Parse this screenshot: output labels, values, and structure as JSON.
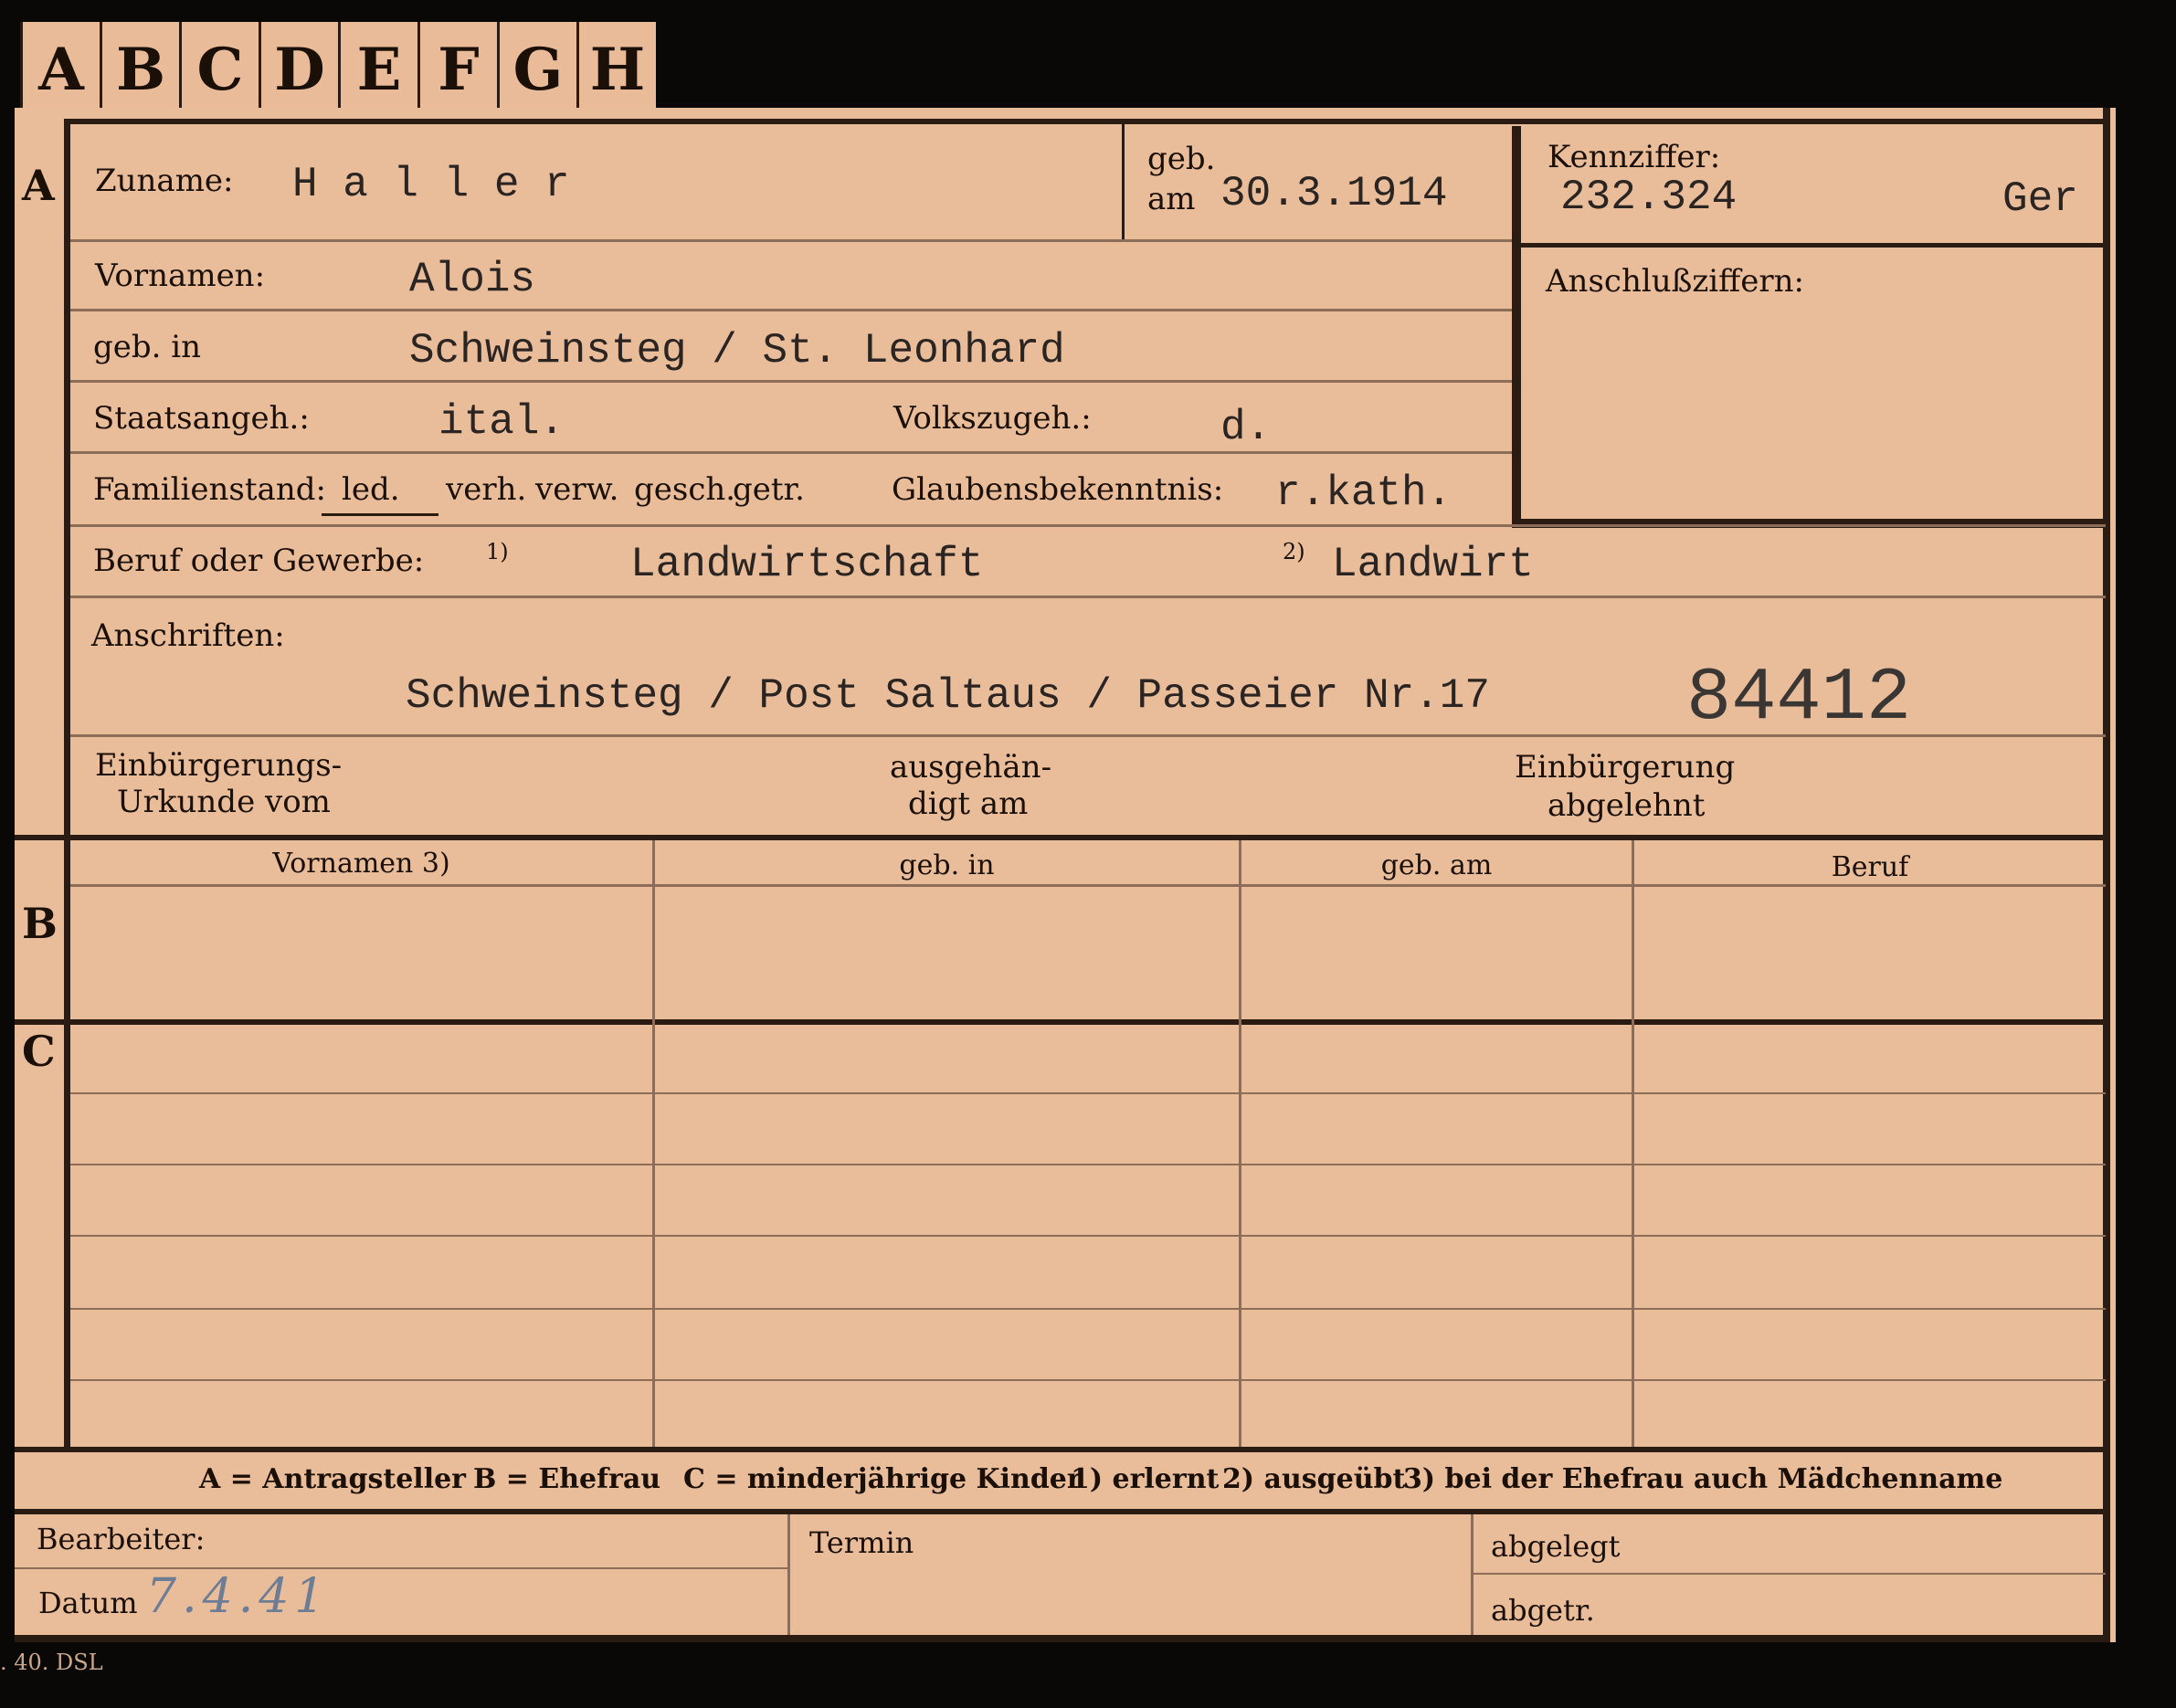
{
  "tabs": [
    "A",
    "B",
    "C",
    "D",
    "E",
    "F",
    "G",
    "H"
  ],
  "sections": {
    "a": "A",
    "b": "B",
    "c": "C"
  },
  "fields": {
    "zuname_label": "Zuname:",
    "zuname_value": "H a l l e r",
    "geb_label": "geb.",
    "geb_am_label": "am",
    "geb_am_value": "30.3.1914",
    "kennziffer_label": "Kennziffer:",
    "kennziffer_value": "232.324",
    "kennziffer_suffix": "Ger",
    "anschluss_label": "Anschlußziffern:",
    "vornamen_label": "Vornamen:",
    "vornamen_value": "Alois",
    "gebin_label": "geb. in",
    "gebin_value": "Schweinsteg / St. Leonhard",
    "staats_label": "Staatsangeh.:",
    "staats_value": "ital.",
    "volks_label": "Volkszugeh.:",
    "volks_value": "d.",
    "familien_label": "Familienstand:",
    "familien_options": [
      "led.",
      "verh.",
      "verw.",
      "gesch.",
      "getr."
    ],
    "glauben_label": "Glaubensbekenntnis:",
    "glauben_value": "r.kath.",
    "beruf_label": "Beruf oder Gewerbe:",
    "beruf_mark1": "1)",
    "beruf_value1": "Landwirtschaft",
    "beruf_mark2": "2)",
    "beruf_value2": "Landwirt",
    "anschriften_label": "Anschriften:",
    "anschriften_value": "Schweinsteg / Post Saltaus / Passeier Nr.17",
    "big_number": "84412",
    "einb_urkunde_label_1": "Einbürgerungs-",
    "einb_urkunde_label_2": "Urkunde vom",
    "ausgehaendigt_label_1": "ausgehän-",
    "ausgehaendigt_label_2": "digt am",
    "einb_abgelehnt_label_1": "Einbürgerung",
    "einb_abgelehnt_label_2": "abgelehnt"
  },
  "table_headers": [
    "Vornamen 3)",
    "geb. in",
    "geb. am",
    "Beruf"
  ],
  "legend": {
    "a": "A = Antragsteller",
    "b": "B = Ehefrau",
    "c": "C = minderjährige Kinder",
    "n1": "1) erlernt",
    "n2": "2) ausgeübt",
    "n3": "3) bei der Ehefrau auch Mädchenname"
  },
  "footer": {
    "bearbeiter_label": "Bearbeiter:",
    "datum_label": "Datum",
    "datum_value": "7.4.41",
    "termin_label": "Termin",
    "abgelegt_label": "abgelegt",
    "abgetr_label": "abgetr."
  },
  "print_code": ". 40. DSL"
}
